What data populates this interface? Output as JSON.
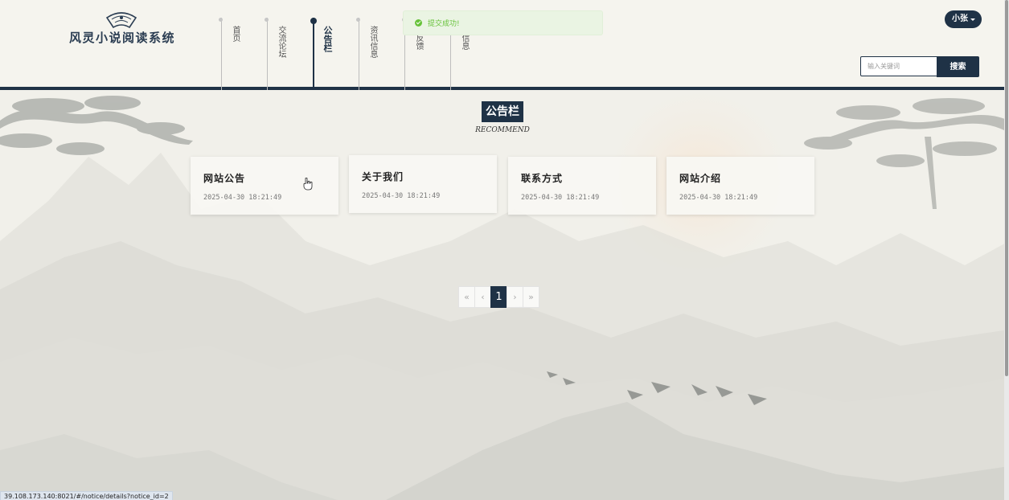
{
  "app": {
    "title": "风灵小说阅读系统",
    "logo_icon": "fan-logo-icon"
  },
  "nav": {
    "items": [
      {
        "label": "首页",
        "active": false
      },
      {
        "label": "交流论坛",
        "active": false
      },
      {
        "label": "公告栏",
        "active": true
      },
      {
        "label": "资讯信息",
        "active": false
      },
      {
        "label": "言反馈",
        "active": false
      },
      {
        "label": "说信息",
        "active": false
      }
    ]
  },
  "user": {
    "name": "小张",
    "icon": "caret-down-icon"
  },
  "search": {
    "placeholder": "输入关键词",
    "button_label": "搜索",
    "value": ""
  },
  "toast": {
    "message": "提交成功!",
    "icon": "success-check-icon",
    "color": "#67c23a"
  },
  "section": {
    "title": "公告栏",
    "subtitle": "RECOMMEND"
  },
  "cards": [
    {
      "title": "网站公告",
      "date": "2025-04-30 18:21:49"
    },
    {
      "title": "关于我们",
      "date": "2025-04-30 18:21:49"
    },
    {
      "title": "联系方式",
      "date": "2025-04-30 18:21:49"
    },
    {
      "title": "网站介绍",
      "date": "2025-04-30 18:21:49"
    }
  ],
  "pagination": {
    "first": "«",
    "prev": "‹",
    "current": "1",
    "next": "›",
    "last": "»"
  },
  "status_bar": {
    "url": "39.108.173.140:8021/#/notice/details?notice_id=2"
  },
  "colors": {
    "primary": "#1f3246",
    "background": "#f3f2ec",
    "success": "#67c23a"
  }
}
